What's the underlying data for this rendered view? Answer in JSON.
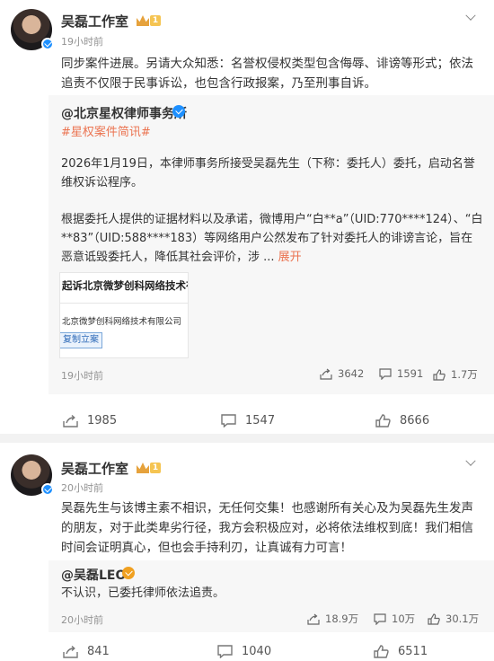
{
  "posts": [
    {
      "author": "吴磊工作室",
      "vip_level": "1",
      "time": "19小时前",
      "text": "同步案件进展。另请大众知悉：名誉权侵权类型包含侮辱、诽谤等形式；依法追责不仅限于民事诉讼，也包含行政报案，乃至刑事自诉。",
      "repost": {
        "author": "@北京星权律师事务所",
        "hashtag": "#星权案件简讯#",
        "paragraph1": "2026年1月19日，本律师事务所接受吴磊先生（下称：委托人）委托，启动名誉维权诉讼程序。",
        "paragraph2": "根据委托人提供的证据材料以及承诺，微博用户“白**a”（UID:770****124）、“白**83”（UID:588****183）等网络用户公然发布了针对委托人的诽谤言论，旨在恶意诋毁委托人，降低其社会评价，涉 ...",
        "expand_label": "展开",
        "preview": {
          "title": "起诉北京微梦创科网络技术有",
          "company": "北京微梦创科网络技术有限公司",
          "button": "复制立案"
        },
        "time": "19小时前",
        "reposts": "3642",
        "comments": "1591",
        "likes": "1.7万"
      },
      "actions": {
        "forward": "1985",
        "comment": "1547",
        "like": "8666"
      }
    },
    {
      "author": "吴磊工作室",
      "vip_level": "1",
      "time": "20小时前",
      "text": "吴磊先生与该博主素不相识，无任何交集！也感谢所有关心及为吴磊先生发声的朋友，对于此类卑劣行径，我方会积极应对，必将依法维权到底！我们相信时间会证明真心，但也会手持利刃，让真诚有力可言！",
      "repost": {
        "author": "@吴磊LEO",
        "text": "不认识，已委托律师依法追责。",
        "time": "20小时前",
        "reposts": "18.9万",
        "comments": "10万",
        "likes": "30.1万"
      },
      "actions": {
        "forward": "841",
        "comment": "1040",
        "like": "6511"
      }
    }
  ],
  "colors": {
    "accent": "#eb7350",
    "verified": "#1e90ff",
    "gold": "#f0a020"
  }
}
